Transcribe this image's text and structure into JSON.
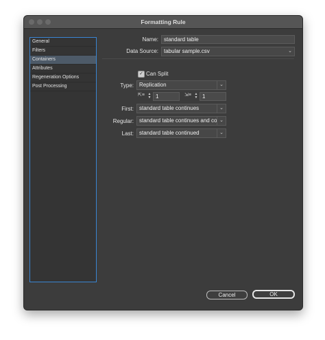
{
  "window": {
    "title": "Formatting Rule"
  },
  "sidebar": {
    "items": [
      {
        "label": "General"
      },
      {
        "label": "Filters"
      },
      {
        "label": "Containers"
      },
      {
        "label": "Attributes"
      },
      {
        "label": "Regeneration Options"
      },
      {
        "label": "Post Processing"
      }
    ],
    "active_index": 2
  },
  "form": {
    "name_label": "Name:",
    "name_value": "standard table",
    "datasource_label": "Data Source:",
    "datasource_value": "tabular sample.csv",
    "can_split_label": "Can Split",
    "can_split_checked": true,
    "type_label": "Type:",
    "type_value": "Replication",
    "spin_left_value": "1",
    "spin_right_value": "1",
    "first_label": "First:",
    "first_value": "standard table continues",
    "regular_label": "Regular:",
    "regular_value": "standard table continues and co",
    "last_label": "Last:",
    "last_value": "standard table continued"
  },
  "buttons": {
    "cancel": "Cancel",
    "ok": "OK"
  },
  "icons": {
    "dropdown": "chevron-down-icon",
    "stepper": "stepper-icon",
    "check": "checkmark-icon"
  }
}
